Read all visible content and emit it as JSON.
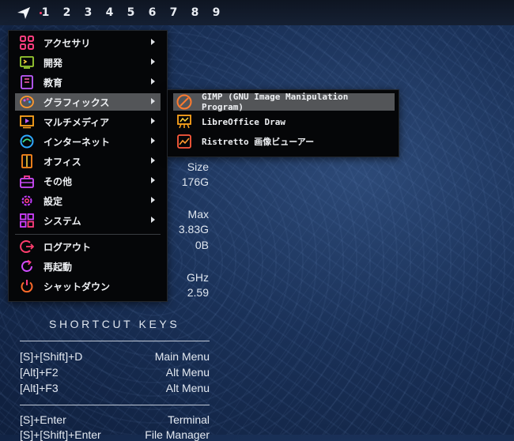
{
  "topbar": {
    "workspaces": [
      "1",
      "2",
      "3",
      "4",
      "5",
      "6",
      "7",
      "8",
      "9"
    ]
  },
  "conky": {
    "size_label": "Size",
    "size_value": "176G",
    "max_label": "Max",
    "max_value1": "3.83G",
    "max_value2": "0B",
    "ghz_label": "GHz",
    "ghz_value": "2.59"
  },
  "shortcuts": {
    "title": "SHORTCUT KEYS",
    "rows": [
      {
        "key": "[S]+[Shift]+D",
        "action": "Main Menu"
      },
      {
        "key": "[Alt]+F2",
        "action": "Alt Menu"
      },
      {
        "key": "[Alt]+F3",
        "action": "Alt Menu"
      },
      {
        "key": "[S]+Enter",
        "action": "Terminal"
      },
      {
        "key": "[S]+[Shift]+Enter",
        "action": "File Manager"
      }
    ]
  },
  "main_menu": {
    "items": [
      {
        "label": "アクセサリ",
        "icon": "accessories-icon",
        "color": "#ff3d7f"
      },
      {
        "label": "開発",
        "icon": "development-icon",
        "color": "#9acd32"
      },
      {
        "label": "教育",
        "icon": "education-icon",
        "color": "#c05cff"
      },
      {
        "label": "グラフィックス",
        "icon": "graphics-icon",
        "color": "#ff9a2e"
      },
      {
        "label": "マルチメディア",
        "icon": "multimedia-icon",
        "color": "#ffa41c"
      },
      {
        "label": "インターネット",
        "icon": "internet-icon",
        "color": "#2ea8ff"
      },
      {
        "label": "オフィス",
        "icon": "office-icon",
        "color": "#ff8a1c"
      },
      {
        "label": "その他",
        "icon": "other-icon",
        "color": "#d04cff"
      },
      {
        "label": "設定",
        "icon": "settings-icon",
        "color": "#c43cff"
      },
      {
        "label": "システム",
        "icon": "system-icon",
        "color": "#d040ff"
      }
    ],
    "session": [
      {
        "label": "ログアウト",
        "icon": "logout-icon",
        "color": "#ff3d6e"
      },
      {
        "label": "再起動",
        "icon": "reboot-icon",
        "color": "#d04cff"
      },
      {
        "label": "シャットダウン",
        "icon": "shutdown-icon",
        "color": "#ff6a2a"
      }
    ]
  },
  "graphics_submenu": {
    "items": [
      {
        "label": "GIMP (GNU Image Manipulation Program)",
        "icon": "gimp-icon"
      },
      {
        "label": "LibreOffice Draw",
        "icon": "libreoffice-draw-icon"
      },
      {
        "label": "Ristretto 画像ビューアー",
        "icon": "ristretto-icon"
      }
    ]
  }
}
